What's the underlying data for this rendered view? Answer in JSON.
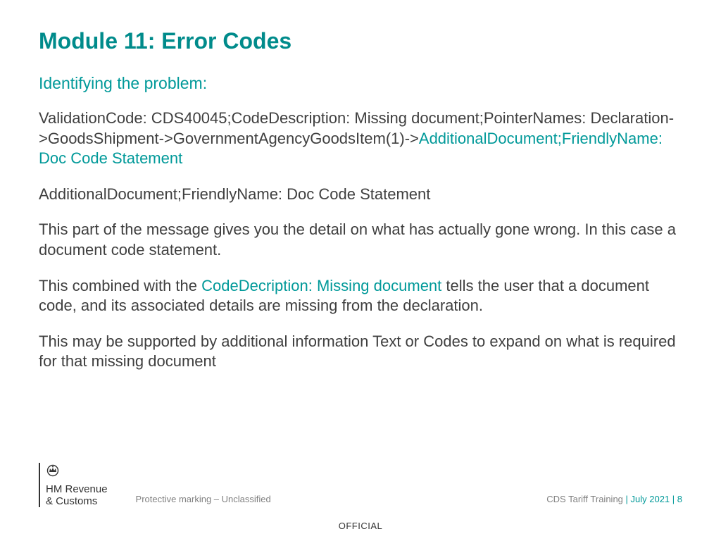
{
  "title": "Module 11: Error Codes",
  "subtitle": "Identifying the problem:",
  "para1": {
    "part1": "ValidationCode: CDS40045;CodeDescription: Missing document;PointerNames: Declaration->GoodsShipment->GovernmentAgencyGoodsItem(1)->",
    "part2": "AdditionalDocument;FriendlyName: Doc Code Statement"
  },
  "para2": "AdditionalDocument;FriendlyName: Doc Code Statement",
  "para3": "This part of the message gives you the detail on what has actually gone wrong.  In this case a document code statement.",
  "para4": {
    "part1": "This combined with the ",
    "part2": "CodeDecription: Missing document",
    "part3": " tells the user that a document code, and its associated details are missing from the declaration."
  },
  "para5": "This may be supported by additional information Text or Codes to expand on what is required for that missing document",
  "logo": {
    "line1": "HM Revenue",
    "line2": "& Customs"
  },
  "footer": {
    "protective": "Protective marking – Unclassified",
    "training": "CDS Tariff Training ",
    "date_sep": " | July 2021 |  ",
    "page": "8",
    "official": "OFFICIAL"
  }
}
